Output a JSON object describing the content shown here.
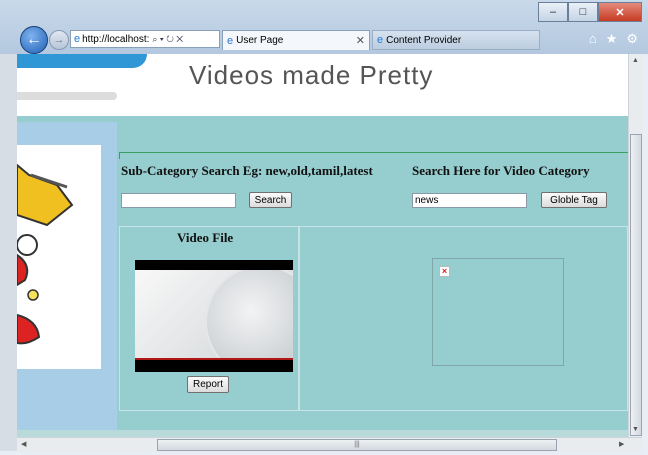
{
  "browser": {
    "address": "http://localhost:",
    "address_icons": "⌕ ▾ ↻ ✕",
    "tabs": [
      {
        "label": "User Page",
        "close": "✕"
      },
      {
        "label": "Content Provider"
      }
    ],
    "toolbar_icons": [
      "home-icon",
      "star-icon",
      "gear-icon"
    ]
  },
  "page": {
    "site_title": "Videos made Pretty",
    "subcategory_label": "Sub-Category Search Eg: new,old,tamil,latest",
    "subcategory_input_value": "",
    "search_button": "Search",
    "category_label": "Search Here for Video Category",
    "category_input_value": "news",
    "globle_tag_button": "Globle Tag",
    "video_file_heading": "Video File",
    "report_button": "Report"
  },
  "colors": {
    "band": "#96cdcf",
    "left_panel": "#a8cde6",
    "title_text": "#555555"
  }
}
